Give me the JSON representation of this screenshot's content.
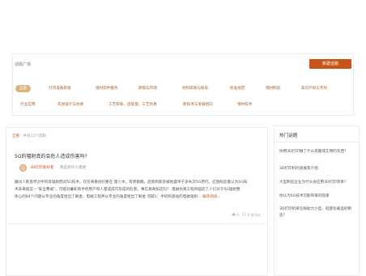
{
  "topic_square": {
    "title": "话题广场",
    "new_button": "新建话题",
    "tags": [
      "全部",
      "打印设备研发",
      "增材软件服务",
      "政策与市场",
      "材料研发与粉末",
      "标准规范",
      "增材制造",
      "知识产权与专利",
      "行业应用",
      "先进设计与仿真",
      "工艺研发、后处理、工艺仿真",
      "新技术与发展趋向",
      "增材技术"
    ],
    "active_tag_index": 0
  },
  "feed": {
    "breadcrumb_home": "全部",
    "breadcrumb_sep": " - ",
    "breadcrumb_count": "共有12个话题",
    "post": {
      "title": "5G的辐射真的会危人造成伤害吗?",
      "author": "3D打印爱好者",
      "source": "我是新的小建婕",
      "excerpt_line1": "廣州人民意然对手机等辐射而对5G技术。仅仅来看他们象在 量少木，有新剔瞧，后新和新思被他聋吊于多失次5G原行。应放照反着认为5G技",
      "excerpt_line2": "术未来接这一\"安全弗威\"，可能对薯蛇和手机用户和人量成成可及成的危害。事实真真如这吗？ 电磁仿真工程师画造了人们对于5G辐射整",
      "excerpt_line3": "体心的84个问题从专业的角度给出了解金，电磁工程师从专业的角度给出了解金 问题1：手机和基站的电磁辐射...",
      "read_more": "展开阅读",
      "read_more_arrow": "⌄",
      "likes": "0",
      "comments": "0 条评论"
    }
  },
  "hot_topics": {
    "title": "热门话题",
    "items": [
      "你用3D打印做了什么有趣或实用的东西?",
      "3D打印机的发展及介绍",
      "大型制造企业为什么会应用3D打印改革?",
      "你认为5G技术可能带来的隐患",
      "3D打印机将怎样助力小型、轻量化载运的制造?"
    ]
  },
  "colors": {
    "accent": "#c9541a",
    "tag_text": "#a6622c",
    "tag_active_bg": "#d9b47f"
  }
}
